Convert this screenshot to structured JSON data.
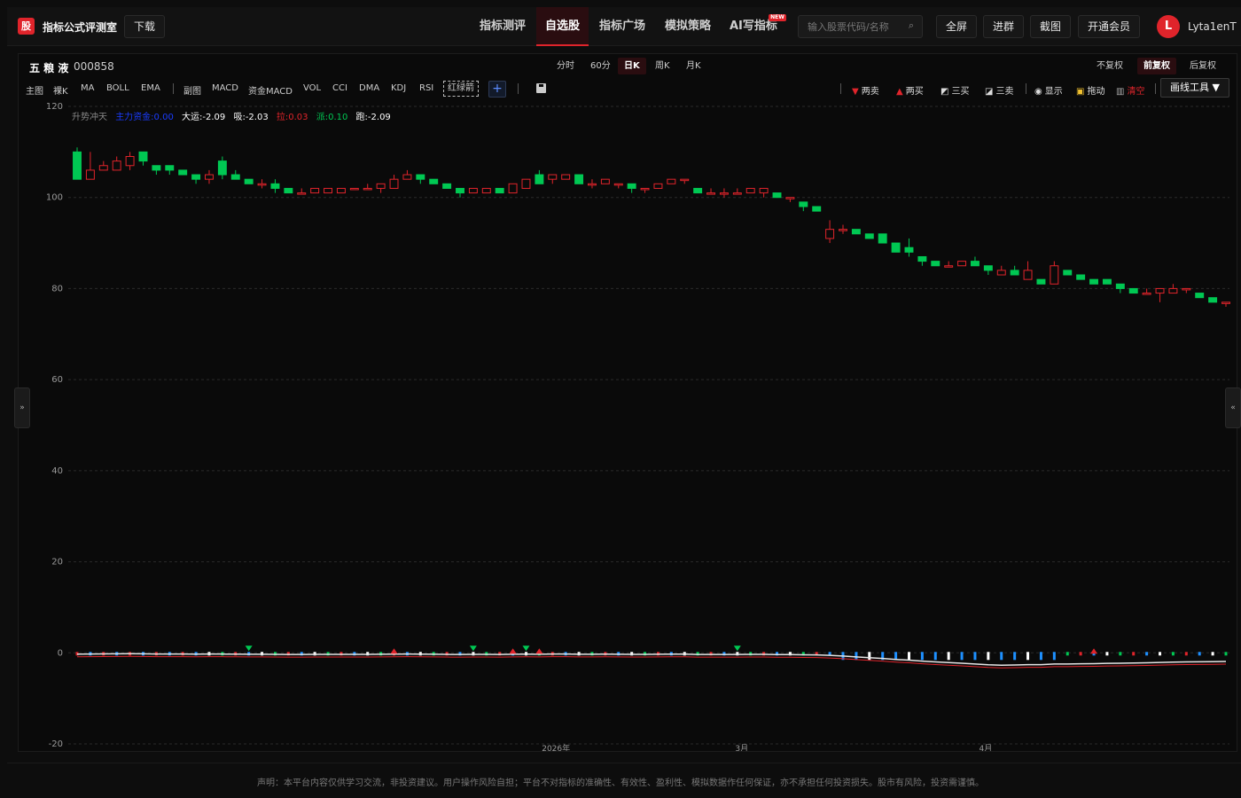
{
  "header": {
    "logo_glyph": "股",
    "title": "指标公式评测室",
    "download": "下载",
    "nav": [
      "指标测评",
      "自选股",
      "指标广场",
      "模拟策略",
      "AI写指标"
    ],
    "nav_active": 1,
    "new_badge": "NEW",
    "search_placeholder": "输入股票代码/名称",
    "actions": [
      "全屏",
      "进群",
      "截图",
      "开通会员"
    ],
    "avatar_letter": "L",
    "username": "Lyta1enT"
  },
  "stock": {
    "name": "五 粮 液",
    "code": "000858"
  },
  "periods": [
    "分时",
    "60分",
    "日K",
    "周K",
    "月K"
  ],
  "period_active": 2,
  "adjust": [
    "不复权",
    "前复权",
    "后复权"
  ],
  "adjust_active": 1,
  "main_ind_label": "主图",
  "main_inds": [
    "裸K",
    "MA",
    "BOLL",
    "EMA"
  ],
  "sub_ind_label": "副图",
  "sub_inds": [
    "MACD",
    "资金MACD",
    "VOL",
    "CCI",
    "DMA",
    "KDJ",
    "RSI"
  ],
  "sub_active": "红绿箭",
  "tools": {
    "two_sell": "两卖",
    "two_buy": "两买",
    "three_buy": "三买",
    "three_sell": "三卖",
    "show": "显示",
    "drag": "拖动",
    "clear": "清空",
    "draw": "画线工具 ▼"
  },
  "indicator_values": {
    "name": "升势冲天",
    "main_label": "主力资金:0.00",
    "big": "大运:-2.09",
    "absorb": "吸:-2.03",
    "pull": "拉:0.03",
    "dispatch": "派:0.10",
    "escape": "跑:-2.09"
  },
  "disclaimer": "声明：本平台内容仅供学习交流，非投资建议。用户操作风险自担；平台不对指标的准确性、有效性、盈利性、模拟数据作任何保证，亦不承担任何投资损失。股市有风险，投资需谨慎。",
  "colors": {
    "up": "#e0242b",
    "down": "#00c853",
    "accent": "#e0242b"
  },
  "chart_data": {
    "type": "candlestick",
    "y_ticks": [
      120,
      100,
      80,
      60,
      40,
      20,
      0,
      -20
    ],
    "ylim": [
      -20,
      120
    ],
    "x_labels": [
      "2026年",
      "3月",
      "4月"
    ],
    "x_label_positions": [
      42,
      58,
      79
    ],
    "candles": [
      [
        110,
        104,
        111,
        104
      ],
      [
        104,
        106,
        110,
        104
      ],
      [
        106,
        107,
        108,
        106
      ],
      [
        106,
        108,
        109,
        106
      ],
      [
        107,
        109,
        110,
        106
      ],
      [
        110,
        108,
        110,
        107
      ],
      [
        107,
        106,
        107,
        105
      ],
      [
        107,
        106,
        107,
        105
      ],
      [
        106,
        105,
        106,
        105
      ],
      [
        105,
        104,
        105,
        103
      ],
      [
        104,
        105,
        106,
        103
      ],
      [
        108,
        105,
        109,
        104
      ],
      [
        105,
        104,
        106,
        104
      ],
      [
        104,
        103,
        104,
        103
      ],
      [
        103,
        103,
        104,
        102
      ],
      [
        103,
        102,
        104,
        101
      ],
      [
        102,
        101,
        102,
        101
      ],
      [
        101,
        101,
        102,
        101
      ],
      [
        101,
        102,
        102,
        101
      ],
      [
        101,
        102,
        102,
        101
      ],
      [
        101,
        102,
        102,
        101
      ],
      [
        102,
        102,
        102,
        102
      ],
      [
        102,
        102,
        103,
        102
      ],
      [
        102,
        103,
        103,
        101
      ],
      [
        102,
        104,
        105,
        102
      ],
      [
        104,
        105,
        106,
        104
      ],
      [
        105,
        104,
        105,
        103
      ],
      [
        104,
        103,
        104,
        103
      ],
      [
        103,
        102,
        103,
        102
      ],
      [
        102,
        101,
        102,
        100
      ],
      [
        101,
        102,
        102,
        101
      ],
      [
        101,
        102,
        102,
        101
      ],
      [
        102,
        101,
        102,
        101
      ],
      [
        101,
        103,
        103,
        101
      ],
      [
        102,
        104,
        104,
        102
      ],
      [
        105,
        103,
        106,
        103
      ],
      [
        104,
        105,
        105,
        103
      ],
      [
        104,
        105,
        105,
        104
      ],
      [
        105,
        103,
        105,
        103
      ],
      [
        103,
        103,
        104,
        102
      ],
      [
        103,
        104,
        104,
        103
      ],
      [
        103,
        103,
        103,
        102
      ],
      [
        103,
        102,
        103,
        101
      ],
      [
        102,
        102,
        102,
        101
      ],
      [
        102,
        103,
        103,
        102
      ],
      [
        103,
        104,
        104,
        103
      ],
      [
        104,
        104,
        104,
        103
      ],
      [
        102,
        101,
        102,
        101
      ],
      [
        101,
        101,
        102,
        101
      ],
      [
        101,
        101,
        102,
        100
      ],
      [
        101,
        101,
        102,
        101
      ],
      [
        101,
        102,
        102,
        101
      ],
      [
        101,
        102,
        102,
        100
      ],
      [
        101,
        100,
        101,
        100
      ],
      [
        100,
        100,
        100,
        99
      ],
      [
        99,
        98,
        99,
        97
      ],
      [
        98,
        97,
        98,
        97
      ],
      [
        91,
        93,
        95,
        90
      ],
      [
        93,
        93,
        94,
        92
      ],
      [
        93,
        92,
        93,
        92
      ],
      [
        92,
        91,
        92,
        91
      ],
      [
        92,
        90,
        92,
        90
      ],
      [
        90,
        88,
        90,
        88
      ],
      [
        89,
        88,
        91,
        87
      ],
      [
        87,
        86,
        87,
        85
      ],
      [
        86,
        85,
        86,
        85
      ],
      [
        85,
        85,
        86,
        85
      ],
      [
        85,
        86,
        86,
        85
      ],
      [
        86,
        85,
        87,
        85
      ],
      [
        85,
        84,
        85,
        83
      ],
      [
        83,
        84,
        85,
        83
      ],
      [
        84,
        83,
        85,
        83
      ],
      [
        82,
        84,
        86,
        82
      ],
      [
        82,
        81,
        82,
        81
      ],
      [
        81,
        85,
        86,
        81
      ],
      [
        84,
        83,
        84,
        83
      ],
      [
        83,
        82,
        83,
        82
      ],
      [
        82,
        81,
        82,
        81
      ],
      [
        82,
        81,
        82,
        81
      ],
      [
        81,
        80,
        81,
        79
      ],
      [
        80,
        79,
        80,
        79
      ],
      [
        79,
        79,
        80,
        79
      ],
      [
        79,
        80,
        80,
        77
      ],
      [
        79,
        80,
        81,
        79
      ],
      [
        80,
        80,
        80,
        79
      ],
      [
        79,
        78,
        79,
        78
      ],
      [
        78,
        77,
        78,
        77
      ],
      [
        77,
        77,
        77,
        76
      ]
    ],
    "arrows": [
      {
        "i": 13,
        "dir": "down"
      },
      {
        "i": 24,
        "dir": "up"
      },
      {
        "i": 30,
        "dir": "down"
      },
      {
        "i": 33,
        "dir": "up"
      },
      {
        "i": 34,
        "dir": "down"
      },
      {
        "i": 35,
        "dir": "up"
      },
      {
        "i": 50,
        "dir": "down"
      },
      {
        "i": 77,
        "dir": "up"
      }
    ]
  }
}
